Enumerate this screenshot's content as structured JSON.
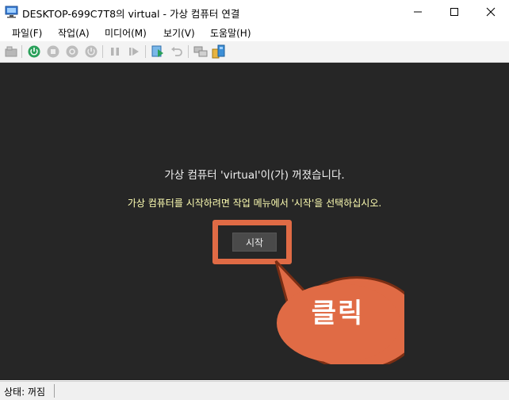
{
  "window": {
    "title": "DESKTOP-699C7T8의 virtual - 가상 컴퓨터 연결",
    "icon": "vm-connect-icon",
    "controls": [
      "minimize-icon",
      "maximize-icon",
      "close-icon"
    ]
  },
  "menu": {
    "items": [
      {
        "label": "파일(F)"
      },
      {
        "label": "작업(A)"
      },
      {
        "label": "미디어(M)"
      },
      {
        "label": "보기(V)"
      },
      {
        "label": "도움말(H)"
      }
    ]
  },
  "toolbar": {
    "buttons": [
      {
        "icon": "ctrl-alt-del-icon"
      },
      {
        "icon": "start-icon"
      },
      {
        "icon": "turn-off-icon"
      },
      {
        "icon": "shut-down-icon"
      },
      {
        "icon": "save-state-icon"
      },
      {
        "icon": "pause-icon"
      },
      {
        "icon": "resume-icon"
      },
      {
        "icon": "checkpoint-icon"
      },
      {
        "icon": "revert-icon"
      },
      {
        "icon": "enhanced-session-icon"
      },
      {
        "icon": "share-icon"
      }
    ]
  },
  "vm": {
    "message_main": "가상 컴퓨터 'virtual'이(가) 꺼졌습니다.",
    "message_hint": "가상 컴퓨터를 시작하려면 작업 메뉴에서 '시작'을 선택하십시오.",
    "start_button_label": "시작"
  },
  "annotation": {
    "callout_text": "클릭",
    "color": "#e06b45"
  },
  "status": {
    "text": "상태: 꺼짐"
  },
  "colors": {
    "vm_background": "#262626",
    "hint_text": "#ffffb3",
    "accent_green": "#2aa05a"
  }
}
